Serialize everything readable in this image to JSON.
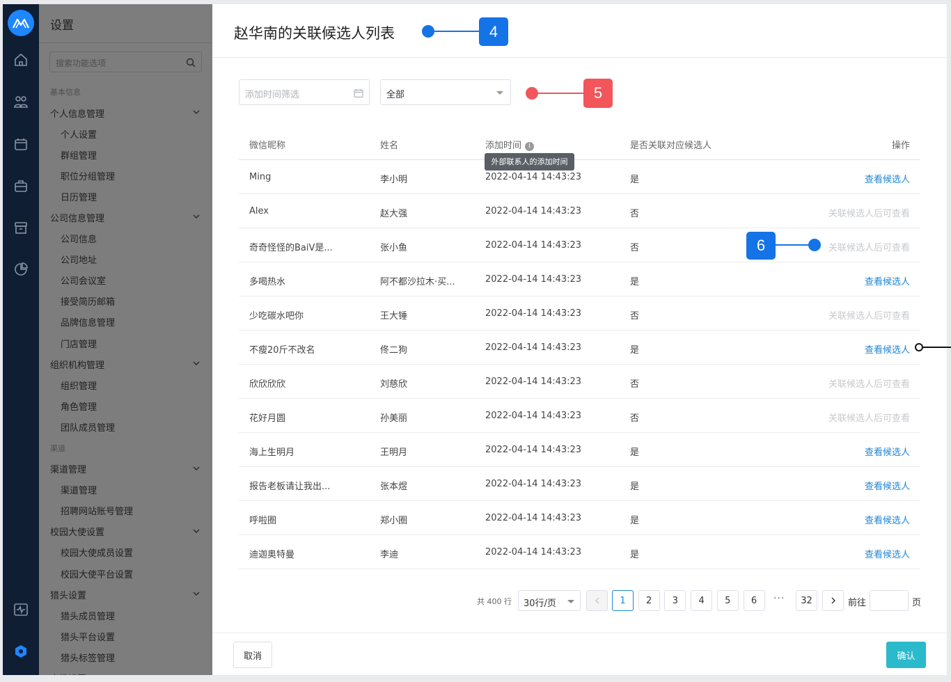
{
  "sidebar": {
    "title": "设置",
    "search_placeholder": "搜索功能选项",
    "menu": [
      {
        "type": "sec",
        "label": "基本信息"
      },
      {
        "type": "grp",
        "label": "个人信息管理"
      },
      {
        "type": "sub",
        "label": "个人设置"
      },
      {
        "type": "sub",
        "label": "群组管理"
      },
      {
        "type": "sub",
        "label": "职位分组管理"
      },
      {
        "type": "sub",
        "label": "日历管理"
      },
      {
        "type": "grp",
        "label": "公司信息管理"
      },
      {
        "type": "sub",
        "label": "公司信息"
      },
      {
        "type": "sub",
        "label": "公司地址"
      },
      {
        "type": "sub",
        "label": "公司会议室"
      },
      {
        "type": "sub",
        "label": "接受简历邮箱"
      },
      {
        "type": "sub",
        "label": "品牌信息管理"
      },
      {
        "type": "sub",
        "label": "门店管理"
      },
      {
        "type": "grp",
        "label": "组织机构管理"
      },
      {
        "type": "sub",
        "label": "组织管理"
      },
      {
        "type": "sub",
        "label": "角色管理"
      },
      {
        "type": "sub",
        "label": "团队成员管理"
      },
      {
        "type": "sec",
        "label": "渠道"
      },
      {
        "type": "grp",
        "label": "渠道管理"
      },
      {
        "type": "sub",
        "label": "渠道管理"
      },
      {
        "type": "sub",
        "label": "招聘网站账号管理"
      },
      {
        "type": "grp",
        "label": "校园大使设置"
      },
      {
        "type": "sub",
        "label": "校园大使成员设置"
      },
      {
        "type": "sub",
        "label": "校园大使平台设置"
      },
      {
        "type": "grp",
        "label": "猎头设置"
      },
      {
        "type": "sub",
        "label": "猎头成员管理"
      },
      {
        "type": "sub",
        "label": "猎头平台设置"
      },
      {
        "type": "sub",
        "label": "猎头标签管理"
      },
      {
        "type": "grp",
        "label": "内推设置"
      }
    ]
  },
  "rail_icons": [
    "home-icon",
    "users-icon",
    "calendar-icon",
    "briefcase-icon",
    "archive-icon",
    "chart-icon"
  ],
  "panel": {
    "title": "赵华南的关联候选人列表",
    "date_filter_placeholder": "添加时间筛选",
    "select_value": "全部",
    "columns": [
      "微信昵称",
      "姓名",
      "添加时间",
      "是否关联对应候选人",
      "操作"
    ],
    "tooltip": "外部联系人的添加时间",
    "rows": [
      {
        "nick": "Ming",
        "name": "李小明",
        "time": "2022-04-14  14:43:23",
        "linked": "是",
        "action": "查看候选人",
        "enabled": true
      },
      {
        "nick": "Alex",
        "name": "赵大强",
        "time": "2022-04-14  14:43:23",
        "linked": "否",
        "action": "关联候选人后可查看",
        "enabled": false
      },
      {
        "nick": "奇奇怪怪的BaiV是...",
        "name": "张小鱼",
        "time": "2022-04-14  14:43:23",
        "linked": "否",
        "action": "关联候选人后可查看",
        "enabled": false
      },
      {
        "nick": "多喝热水",
        "name": "阿不都沙拉木·买...",
        "time": "2022-04-14  14:43:23",
        "linked": "是",
        "action": "查看候选人",
        "enabled": true
      },
      {
        "nick": "少吃碳水吧你",
        "name": "王大锤",
        "time": "2022-04-14  14:43:23",
        "linked": "否",
        "action": "关联候选人后可查看",
        "enabled": false
      },
      {
        "nick": "不瘦20斤不改名",
        "name": "佟二狗",
        "time": "2022-04-14  14:43:23",
        "linked": "是",
        "action": "查看候选人",
        "enabled": true
      },
      {
        "nick": "欣欣欣欣",
        "name": "刘慈欣",
        "time": "2022-04-14  14:43:23",
        "linked": "否",
        "action": "关联候选人后可查看",
        "enabled": false
      },
      {
        "nick": "花好月圆",
        "name": "孙美丽",
        "time": "2022-04-14  14:43:23",
        "linked": "否",
        "action": "关联候选人后可查看",
        "enabled": false
      },
      {
        "nick": "海上生明月",
        "name": "王明月",
        "time": "2022-04-14  14:43:23",
        "linked": "是",
        "action": "查看候选人",
        "enabled": true
      },
      {
        "nick": "报告老板请让我出...",
        "name": "张本煜",
        "time": "2022-04-14  14:43:23",
        "linked": "是",
        "action": "查看候选人",
        "enabled": true
      },
      {
        "nick": "呼啦圈",
        "name": "郑小圈",
        "time": "2022-04-14  14:43:23",
        "linked": "是",
        "action": "查看候选人",
        "enabled": true
      },
      {
        "nick": "迪迦奥特曼",
        "name": "李迪",
        "time": "2022-04-14  14:43:23",
        "linked": "是",
        "action": "查看候选人",
        "enabled": true
      }
    ],
    "pager": {
      "total": "共 400 行",
      "page_size": "30行/页",
      "pages": [
        "1",
        "2",
        "3",
        "4",
        "5",
        "6"
      ],
      "ellipsis": "···",
      "last": "32",
      "current": "1",
      "goto_label": "前往",
      "goto_suffix": "页"
    },
    "cancel_label": "取消",
    "ok_label": "确认"
  },
  "annotations": [
    {
      "label": "4",
      "color": "#1473e6"
    },
    {
      "label": "5",
      "color": "#f2555a"
    },
    {
      "label": "6",
      "color": "#1473e6"
    }
  ],
  "colors": {
    "link": "#1e86d8",
    "confirm": "#2bb9cc",
    "rail": "#0f1e33",
    "accent_logo": "#1e86ff"
  }
}
